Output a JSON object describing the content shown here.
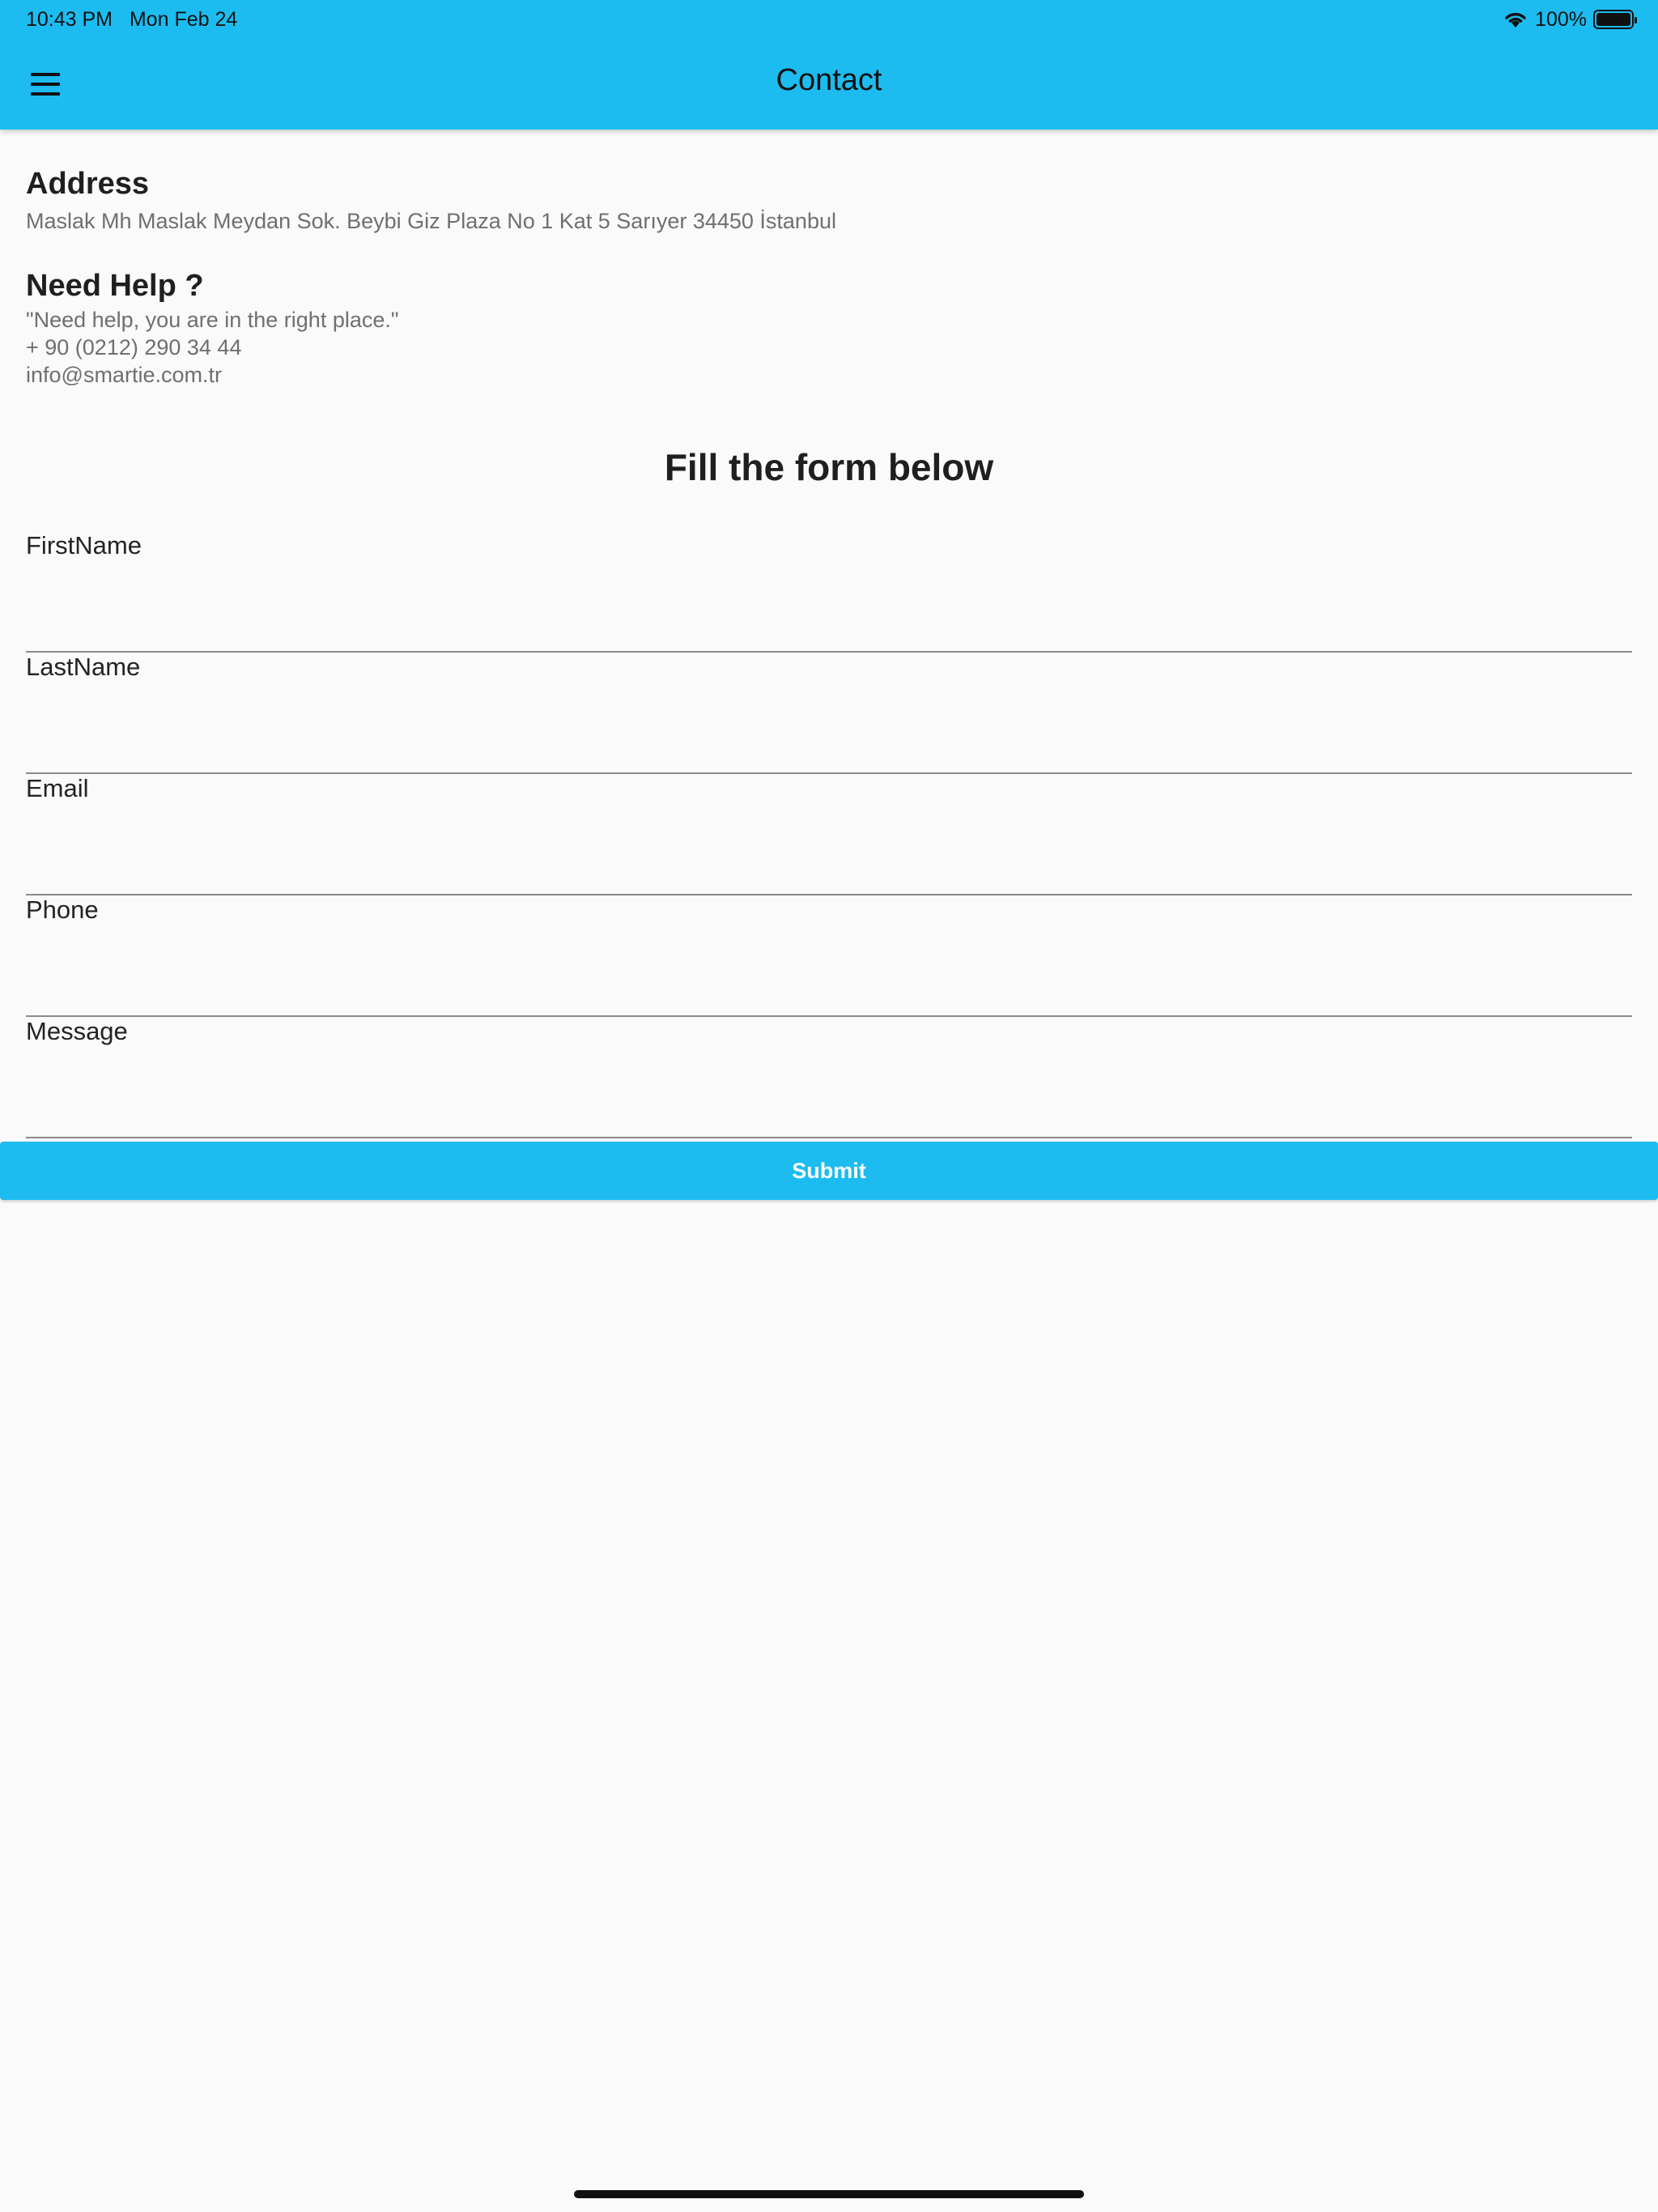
{
  "status_bar": {
    "time": "10:43 PM",
    "date": "Mon Feb 24",
    "battery": "100%",
    "icons": [
      "wifi-icon",
      "battery-icon"
    ]
  },
  "header": {
    "title": "Contact",
    "menu_icon": "hamburger-menu-icon",
    "background_color": "#1cbcf0"
  },
  "address": {
    "title": "Address",
    "text": "Maslak Mh Maslak Meydan Sok. Beybi Giz Plaza No 1 Kat 5 Sarıyer 34450 İstanbul"
  },
  "help": {
    "title": "Need Help ?",
    "quote": "\"Need help, you are in the right place.\"",
    "phone": "+ 90 (0212) 290 34 44",
    "email": "info@smartie.com.tr"
  },
  "form": {
    "title": "Fill the form below",
    "fields": [
      {
        "label": "FirstName",
        "value": ""
      },
      {
        "label": "LastName",
        "value": ""
      },
      {
        "label": "Email",
        "value": ""
      },
      {
        "label": "Phone",
        "value": ""
      },
      {
        "label": "Message",
        "value": ""
      }
    ],
    "submit_label": "Submit",
    "button_color": "#1cbcf0"
  }
}
